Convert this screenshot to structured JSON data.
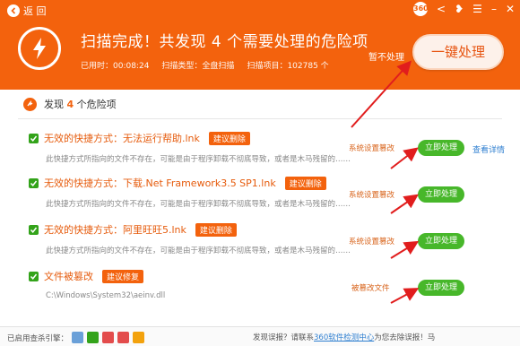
{
  "header": {
    "back_label": "返 回",
    "title": "扫描完成！共发现  4  个需要处理的危险项",
    "elapsed": "已用时：00:08:24",
    "scan_type": "扫描类型：全盘扫描",
    "scan_items": "扫描项目：102785 个",
    "ignore_label": "暂不处理",
    "fix_all_label": "一键处理",
    "brand_badge": "360"
  },
  "summary": {
    "prefix": "发现",
    "count": "4",
    "suffix": "个危险项"
  },
  "items": [
    {
      "title": "无效的快捷方式：无法运行帮助.lnk",
      "tag": "建议删除",
      "desc": "此快捷方式所指向的文件不存在，可能是由于程序卸载不彻底导致，或者是木马残留的……",
      "category": "系统设置篡改",
      "action": "立即处理",
      "detail": "查看详情"
    },
    {
      "title": "无效的快捷方式：下载.Net Framework3.5 SP1.lnk",
      "tag": "建议删除",
      "desc": "此快捷方式所指向的文件不存在，可能是由于程序卸载不彻底导致，或者是木马残留的……",
      "category": "系统设置篡改",
      "action": "立即处理"
    },
    {
      "title": "无效的快捷方式：阿里旺旺5.lnk",
      "tag": "建议删除",
      "desc": "此快捷方式所指向的文件不存在，可能是由于程序卸载不彻底导致，或者是木马残留的……",
      "category": "系统设置篡改",
      "action": "立即处理"
    },
    {
      "title": "文件被篡改",
      "tag": "建议修复",
      "desc": "C:\\Windows\\System32\\aeinv.dll",
      "category": "被篡改文件",
      "action": "立即处理"
    }
  ],
  "footer": {
    "engines_label": "已启用查杀引擎：",
    "feedback_pre": "发现误报？请联系",
    "feedback_link": "360软件检测中心",
    "feedback_post": "为您去除误报！马",
    "engine_colors": [
      "#6aa0d8",
      "#33a31a",
      "#e34c4c",
      "#e34c4c",
      "#f3a20d"
    ]
  },
  "colors": {
    "brand": "#f3620d",
    "action_green": "#47b72a",
    "arrow_red": "#e11d1d"
  }
}
